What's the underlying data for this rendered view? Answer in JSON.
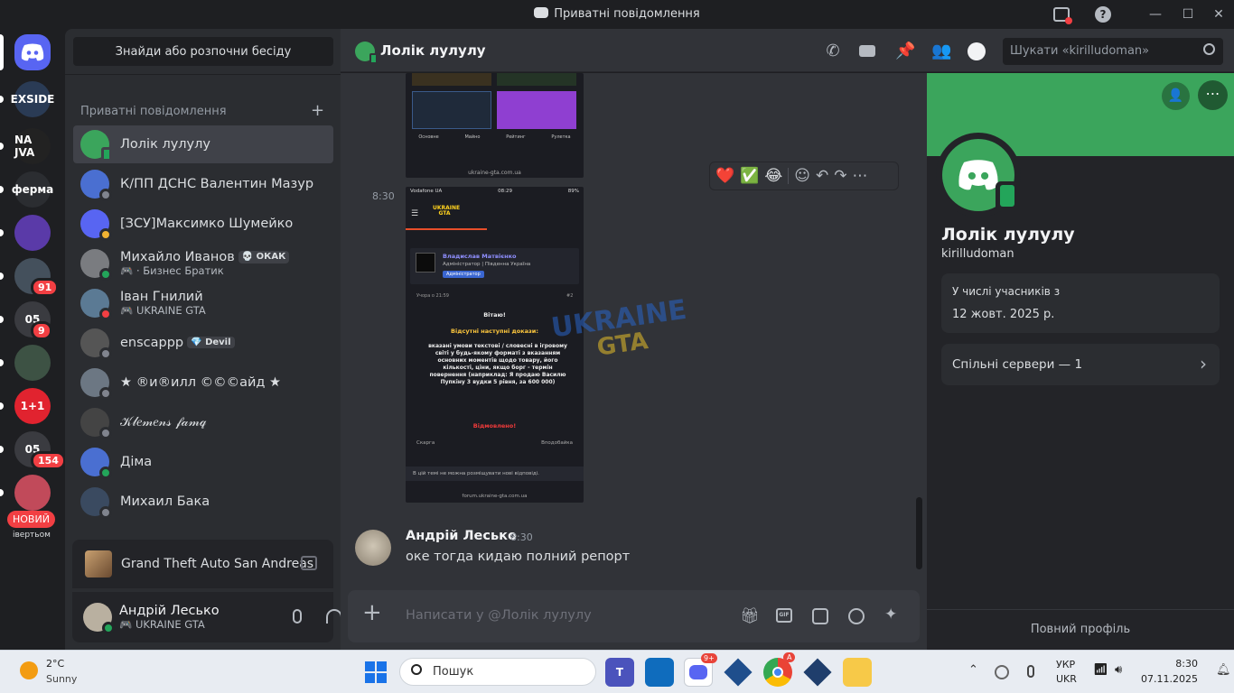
{
  "window": {
    "title": "Приватні повідомлення"
  },
  "servers": [
    {
      "label": "EXSIDE",
      "color": "#2a3b55"
    },
    {
      "label": "NA JVA",
      "color": "#222"
    },
    {
      "label": "ферма",
      "color": "#2b2d31"
    },
    {
      "label": "",
      "color": "#5a3aa8"
    },
    {
      "label": "",
      "color": "#44505c",
      "badge": "91"
    },
    {
      "label": "05",
      "color": "#3a3b40",
      "badge": "9"
    },
    {
      "label": "",
      "color": "#3d5244"
    },
    {
      "label": "1+1",
      "color": "#e1232f"
    },
    {
      "label": "05",
      "color": "#3a3b40",
      "badge": "154"
    },
    {
      "label": "",
      "color": "#c14a5a"
    }
  ],
  "server_new_badge": "НОВИЙ",
  "server_partial_label": "івертьом",
  "dm_sidebar": {
    "find_button": "Знайди або розпочни бесіду",
    "header": "Приватні повідомлення",
    "items": [
      {
        "name": "Лолік лулулу",
        "sub": "",
        "tag": "",
        "avatar": "#3ba55c",
        "status": "#23a55a"
      },
      {
        "name": "К/ПП ДСНС Валентин Мазур",
        "sub": "",
        "tag": "",
        "avatar": "#4a6fd1",
        "status": "#80848e"
      },
      {
        "name": "[ЗСУ]Максимко Шумейко",
        "sub": "",
        "tag": "",
        "avatar": "#5865f2",
        "status": "#f0b232"
      },
      {
        "name": "Михайло Иванов",
        "sub": "🎮 · Бизнес Братик",
        "tag": "💀 ОКАК",
        "avatar": "#7a7c80",
        "status": "#23a55a"
      },
      {
        "name": "Іван Гнилий",
        "sub": "🎮 UKRAINE GTA",
        "tag": "",
        "avatar": "#5b7a94",
        "status": "#f23f43"
      },
      {
        "name": "enscappp",
        "sub": "",
        "tag": "💎 Devil",
        "avatar": "#555",
        "status": "#80848e"
      },
      {
        "name": "★ ®и®илл ©©©айд ★",
        "sub": "",
        "tag": "",
        "avatar": "#6c7783",
        "status": "#80848e"
      },
      {
        "name": "𝒦𝓁𝑒𝓂𝑒𝓃𝓈 𝒻𝒶𝓂𝓆",
        "sub": "",
        "tag": "",
        "avatar": "#444",
        "status": "#80848e"
      },
      {
        "name": "Діма",
        "sub": "",
        "tag": "",
        "avatar": "#4a6fd1",
        "status": "#23a55a"
      },
      {
        "name": "Михаил Бака",
        "sub": "",
        "tag": "",
        "avatar": "#3a4a60",
        "status": "#80848e"
      }
    ]
  },
  "activity": {
    "game": "Grand Theft Auto San Andreas"
  },
  "user_panel": {
    "name": "Андрій Лесько",
    "status": "🎮 UKRAINE GTA"
  },
  "chat_header": {
    "name": "Лолік лулулу",
    "search_placeholder": "Шукати «kirilludoman»"
  },
  "screenshot1": {
    "tabs": [
      "Основне",
      "Майно",
      "Рейтинг",
      "Рулетка"
    ],
    "url": "ukraine-gta.com.ua"
  },
  "screenshot2": {
    "time_label": "8:30",
    "status_carrier": "Vodafone UA",
    "status_time": "08:29",
    "status_battery": "89%",
    "logo": "UKRAINE GTA",
    "author": "Владислав Матвієнко",
    "author_role": "Адміністратор | Південна Україна",
    "author_badge": "Адміністратор",
    "post_meta": "Учора о 21:59",
    "post_num": "#2",
    "greeting": "Вітаю!",
    "missing": "Відсутні наступні докази:",
    "bullet": "вказані умови текстові / словесні в ігровому світі у будь-якому форматі з вказанням основних моментів щодо товару, його кількості, ціни, якщо борг - термін повернення (наприклад: Я продаю Василю Пупкіну 3 вудки 5 рівня, за 600 000)",
    "rejected": "Відмовлено!",
    "complain": "Скарга",
    "like": "Вподобайка",
    "closed": "В цій темі не можна розміщувати нові відповіді.",
    "url": "forum.ukraine-gta.com.ua"
  },
  "watermark": {
    "line1": "UKRAINE",
    "line2": "GTA"
  },
  "reactions": [
    "❤️",
    "✅",
    "😂"
  ],
  "message": {
    "author": "Андрій Лесько",
    "time": "8:30",
    "text": "оке тогда кидаю полний репорт"
  },
  "composer": {
    "placeholder": "Написати у @Лолік лулулу"
  },
  "profile": {
    "name": "Лолік лулулу",
    "username": "kirilludoman",
    "member_since_label": "У числі учасників з",
    "member_since": "12 жовт. 2025 р.",
    "mutual_servers": "Спільні сервери — 1",
    "full_profile": "Повний профіль"
  },
  "taskbar": {
    "weather_temp": "2°C",
    "weather_desc": "Sunny",
    "search": "Пошук",
    "discord_badge": "9+",
    "chrome_badge": "A",
    "lang1": "УКР",
    "lang2": "UKR",
    "time": "8:30",
    "date": "07.11.2025"
  },
  "colors": {
    "accent": "#5865f2",
    "green": "#3ba55c",
    "bg": "#313338",
    "sidebar": "#2b2d31"
  }
}
